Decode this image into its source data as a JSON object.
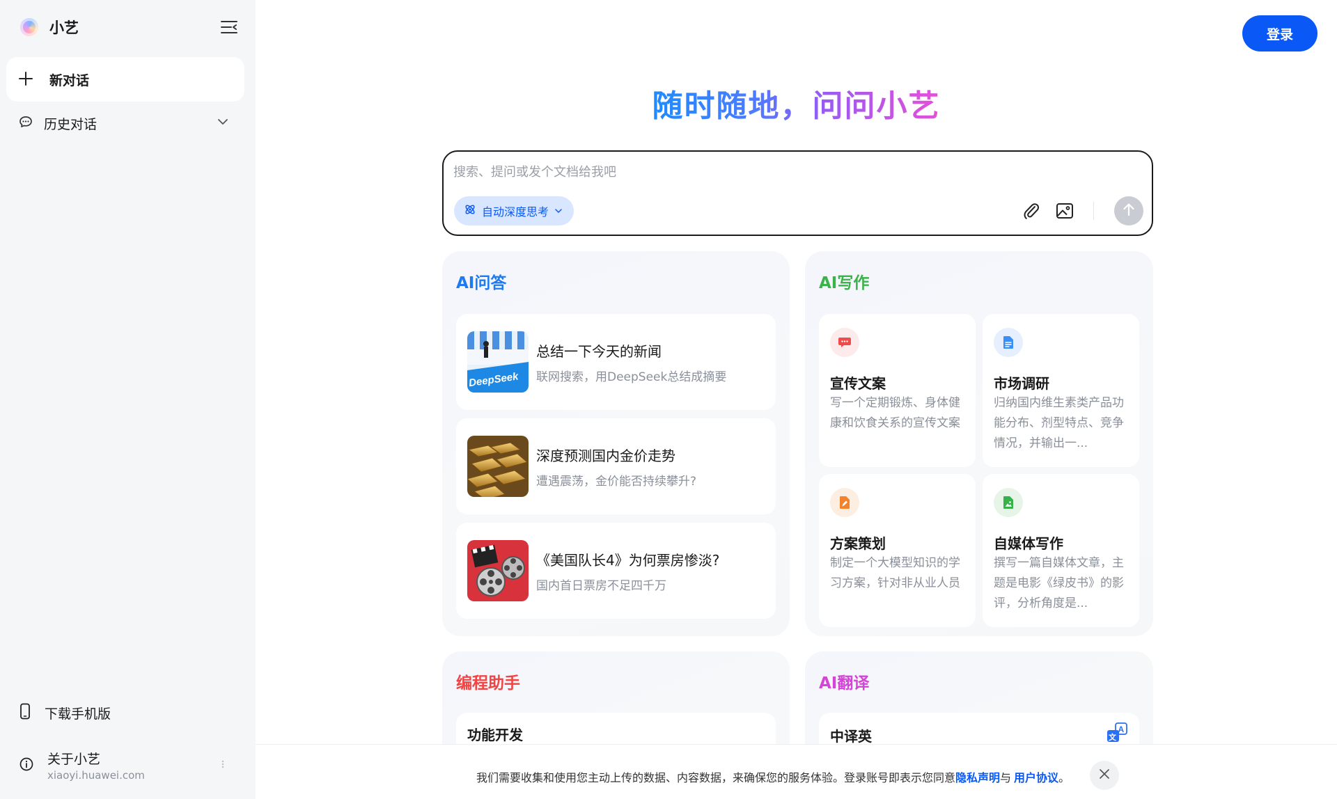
{
  "sidebar": {
    "brand_name": "小艺",
    "new_chat_label": "新对话",
    "history_label": "历史对话",
    "download_label": "下载手机版",
    "about_label": "关于小艺",
    "about_domain": "xiaoyi.huawei.com"
  },
  "header": {
    "login_label": "登录"
  },
  "hero": {
    "title": "随时随地，问问小艺"
  },
  "composer": {
    "placeholder": "搜索、提问或发个文档给我吧",
    "think_mode_label": "自动深度思考"
  },
  "qa": {
    "title": "AI问答",
    "title_color": "#1e7bef",
    "items": [
      {
        "title": "总结一下今天的新闻",
        "subtitle": "联网搜索，用DeepSeek总结成摘要",
        "thumb_text": "DeepSeek"
      },
      {
        "title": "深度预测国内金价走势",
        "subtitle": "遭遇震荡，金价能否持续攀升?"
      },
      {
        "title": "《美国队长4》为何票房惨淡?",
        "subtitle": "国内首日票房不足四千万"
      }
    ]
  },
  "writing": {
    "title": "AI写作",
    "title_color": "#3cb34a",
    "items": [
      {
        "title": "宣传文案",
        "desc": "写一个定期锻炼、身体健康和饮食关系的宣传文案",
        "icon": "chat-bubble-icon",
        "color": "#f04b4b"
      },
      {
        "title": "市场调研",
        "desc": "归纳国内维生素类产品功能分布、剂型特点、竞争情况，并输出一...",
        "icon": "document-icon",
        "color": "#3a8ef6"
      },
      {
        "title": "方案策划",
        "desc": "制定一个大模型知识的学习方案，针对非从业人员",
        "icon": "edit-document-icon",
        "color": "#f2822c"
      },
      {
        "title": "自媒体写作",
        "desc": "撰写一篇自媒体文章，主题是电影《绿皮书》的影评，分析角度是...",
        "icon": "image-document-icon",
        "color": "#35b24a"
      }
    ]
  },
  "coding": {
    "title": "编程助手",
    "title_color": "#f04545",
    "items": [
      {
        "title": "功能开发"
      }
    ]
  },
  "translate": {
    "title": "AI翻译",
    "title_color": "#d444d6",
    "items": [
      {
        "title": "中译英"
      }
    ]
  },
  "consent": {
    "text_before": "我们需要收集和使用您主动上传的数据、内容数据，来确保您的服务体验。登录账号即表示您同意",
    "privacy_link": "隐私声明",
    "joiner": "与",
    "terms_link": "用户协议",
    "text_after": "。"
  }
}
